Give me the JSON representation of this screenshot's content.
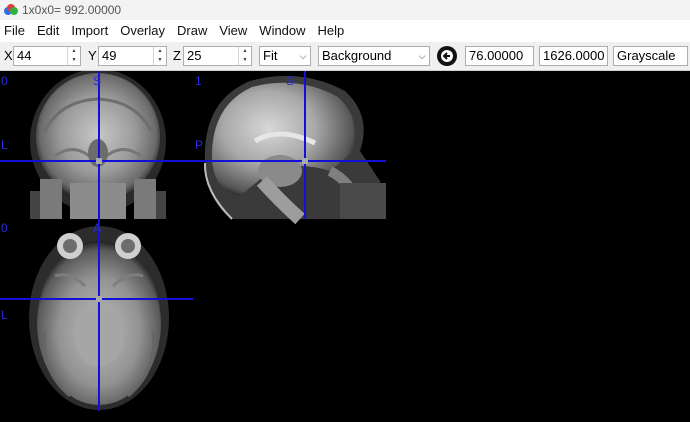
{
  "window": {
    "title": "1x0x0= 992.00000"
  },
  "menu": [
    "File",
    "Edit",
    "Import",
    "Overlay",
    "Draw",
    "View",
    "Window",
    "Help"
  ],
  "toolbar": {
    "x_label": "X",
    "x_value": "44",
    "y_label": "Y",
    "y_value": "49",
    "z_label": "Z",
    "z_value": "25",
    "zoom_value": "Fit",
    "layer_value": "Background",
    "contrast_min": "76.00000",
    "contrast_max": "1626.0000",
    "colormap_value": "Grayscale"
  },
  "views": {
    "coronal": {
      "index": "0",
      "top": "S",
      "left": "L"
    },
    "sagittal": {
      "index": "1",
      "top": "S",
      "left": "P"
    },
    "axial": {
      "index": "0",
      "top": "A",
      "left": "L"
    }
  },
  "colors": {
    "crosshair": "#1010d8",
    "orientation_label": "#2a2ae0"
  },
  "icons": {
    "app": "app-logo-icon",
    "contrast": "contrast-arrow-icon"
  }
}
